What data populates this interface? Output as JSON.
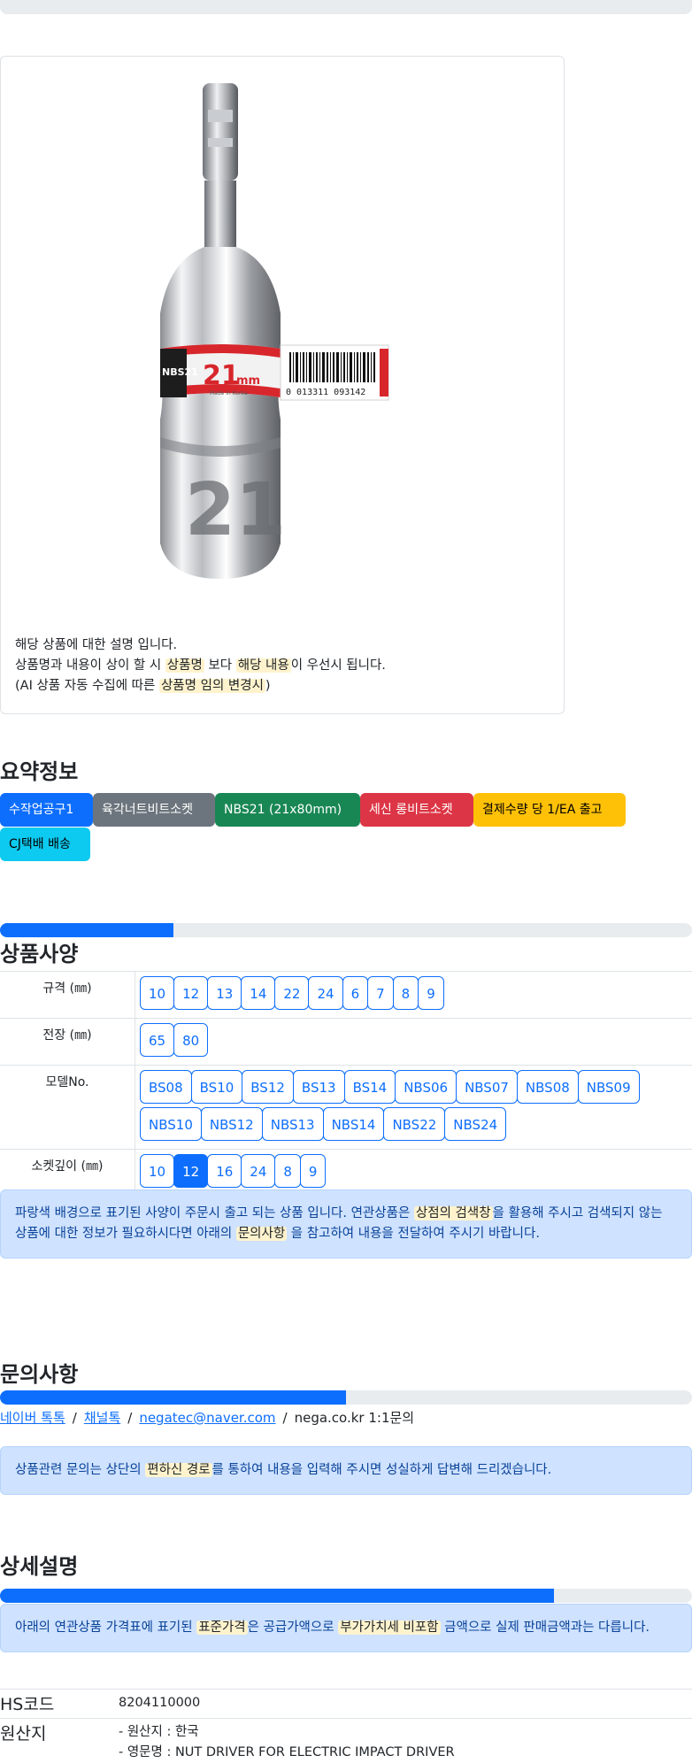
{
  "product": {
    "image_alt": "NBS21 21mm nut driver bit socket",
    "label_size": "21",
    "label_unit": "mm",
    "label_model": "NBS21",
    "label_made": "Made in Korea",
    "barcode_number": "0 013311 093142",
    "engraved_number": "21",
    "desc_line1": "해당 상품에 대한 설명 입니다.",
    "desc_line2_a": "상품명과 내용이 상이 할 시 ",
    "desc_line2_mark1": "상품명",
    "desc_line2_b": " 보다 ",
    "desc_line2_mark2": "해당 내용",
    "desc_line2_c": "이 우선시 됩니다.",
    "desc_line3_a": "(AI 상품 자동 수집에 따른 ",
    "desc_line3_mark": "상품명 임의 변경시",
    "desc_line3_b": ")"
  },
  "summary": {
    "title": "요약정보",
    "tags": [
      {
        "label": "수작업공구1",
        "bg": "#0d6efd",
        "fg": "#ffffff"
      },
      {
        "label": "육각너트비트소켓",
        "bg": "#6c757d",
        "fg": "#ffffff"
      },
      {
        "label": "NBS21 (21x80mm)",
        "bg": "#198754",
        "fg": "#ffffff"
      },
      {
        "label": "세신 롱비트소켓",
        "bg": "#dc3545",
        "fg": "#ffffff"
      },
      {
        "label": "결제수량 당 1/EA 출고",
        "bg": "#ffc107",
        "fg": "#000000"
      },
      {
        "label": "CJ택배 배송",
        "bg": "#0dcaf0",
        "fg": "#000000"
      }
    ]
  },
  "specs": {
    "title": "상품사양",
    "progress_fraction": 0.25,
    "rows": [
      {
        "label": "규격 (㎜)",
        "values": [
          "10",
          "12",
          "13",
          "14",
          "22",
          "24",
          "6",
          "7",
          "8",
          "9"
        ],
        "active": -1
      },
      {
        "label": "전장 (㎜)",
        "values": [
          "65",
          "80"
        ],
        "active": -1
      },
      {
        "label": "모델No.",
        "values": [
          "BS08",
          "BS10",
          "BS12",
          "BS13",
          "BS14",
          "NBS06",
          "NBS07",
          "NBS08",
          "NBS09",
          "NBS10",
          "NBS12",
          "NBS13",
          "NBS14",
          "NBS22",
          "NBS24"
        ],
        "active": -1
      },
      {
        "label": "소켓깊이 (㎜)",
        "values": [
          "10",
          "12",
          "16",
          "24",
          "8",
          "9"
        ],
        "active": 1
      }
    ],
    "note_a": "파랑색 배경으로 표기된 사양이 주문시 출고 되는 상품 입니다. 연관상품은 ",
    "note_mark1": "상점의 검색창",
    "note_b": "을 활용해 주시고 검색되지 않는 상품에 대한 정보가 필요하시다면 아래의 ",
    "note_mark2": "문의사항",
    "note_c": " 을 참고하여 내용을 전달하여 주시기 바랍니다."
  },
  "inquiry": {
    "title": "문의사항",
    "progress_fraction": 0.5,
    "link1": "네이버 톡톡",
    "link2": "채널톡",
    "link3": "negatec@naver.com",
    "text4": "nega.co.kr 1:1문의",
    "sep": "/",
    "note_a": "상품관련 문의는 상단의 ",
    "note_mark": "편하신 경로",
    "note_b": "를 통하여 내용을 입력해 주시면 성실하게 답변해 드리겠습니다."
  },
  "detail": {
    "title": "상세설명",
    "progress_fraction": 0.8,
    "note_a": "아래의 연관상품 가격표에 표기된 ",
    "note_mark1": "표준가격",
    "note_b": "은 공급가액으로 ",
    "note_mark2": "부가가치세 비포함",
    "note_c": " 금액으로 실제 판매금액과는 다릅니다.",
    "hs_label": "HS코드",
    "hs_value": "8204110000",
    "origin_label": "원산지",
    "origin_line1": "- 원산지 : 한국",
    "origin_line2": "- 영문명 : NUT DRIVER FOR ELECTRIC IMPACT DRIVER"
  }
}
